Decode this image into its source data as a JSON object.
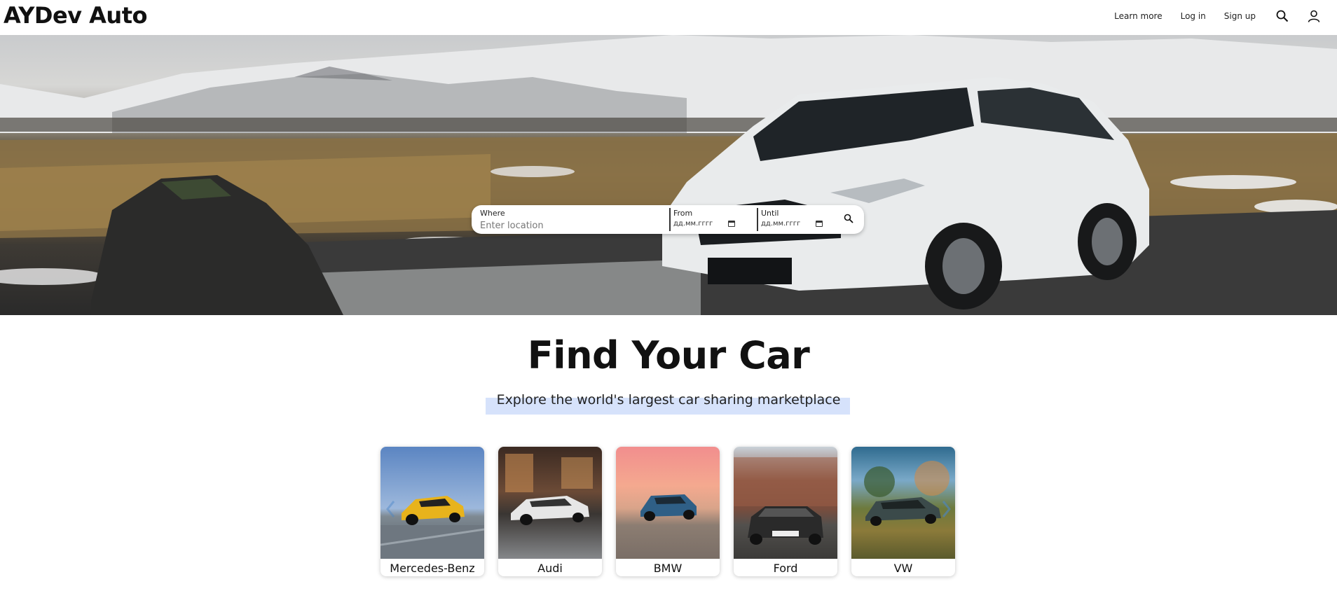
{
  "header": {
    "logo": "AYDev Auto",
    "nav": {
      "learn_more": "Learn more",
      "log_in": "Log in",
      "sign_up": "Sign up"
    },
    "icons": [
      "search-icon",
      "user-icon"
    ]
  },
  "search": {
    "where_label": "Where",
    "where_placeholder": "Enter location",
    "from_label": "From",
    "from_value": "дд.мм.гггг",
    "until_label": "Until",
    "until_value": "дд.мм.гггг"
  },
  "main": {
    "title": "Find Your Car",
    "subtitle": "Explore the world's largest car sharing marketplace"
  },
  "brands": [
    {
      "name": "Mercedes-Benz",
      "car_color": "#e8b31c"
    },
    {
      "name": "Audi",
      "car_color": "#e6e6e6"
    },
    {
      "name": "BMW",
      "car_color": "#2f5f86"
    },
    {
      "name": "Ford",
      "car_color": "#2a2a2a"
    },
    {
      "name": "VW",
      "car_color": "#3b4a4a"
    }
  ],
  "colors": {
    "subtitle_highlight": "#d6e2fb",
    "text": "#111111"
  }
}
